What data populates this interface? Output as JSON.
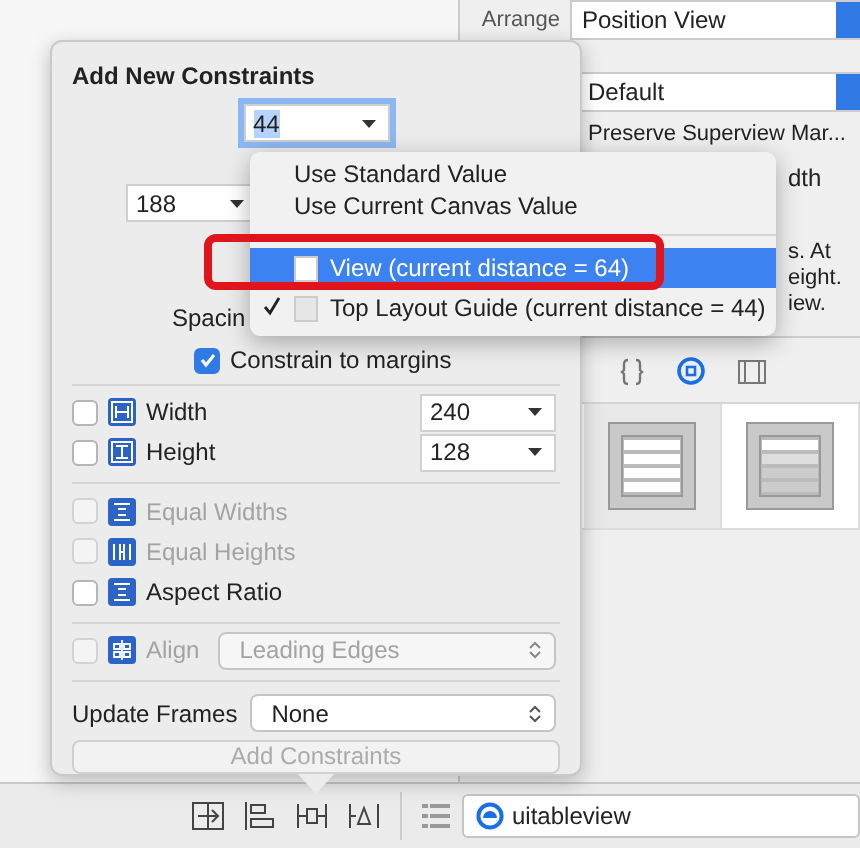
{
  "inspector": {
    "arrange_label": "Arrange",
    "arrange_value": "Position View",
    "layout_value": "Default",
    "preserve_label": "Preserve Superview Mar...",
    "fragments": [
      "dth",
      "s. At",
      "eight.",
      "iew."
    ],
    "library_tabs": [
      {
        "kind": "braces",
        "selected": false
      },
      {
        "kind": "target",
        "selected": true
      },
      {
        "kind": "panel",
        "selected": false
      }
    ],
    "library_cells": [
      {
        "selected": true
      },
      {
        "selected": false
      }
    ]
  },
  "bottom_bar": {
    "tools": [
      {
        "kind": "embed"
      },
      {
        "kind": "align"
      },
      {
        "kind": "pin"
      },
      {
        "kind": "resolve"
      }
    ],
    "search_value": "uitableview"
  },
  "popover": {
    "title": "Add New Constraints",
    "top_field": {
      "value": "44",
      "focused": true
    },
    "left_field": {
      "value": "188"
    },
    "spacing_label": "Spacin",
    "constrain_margins": {
      "label": "Constrain to margins",
      "checked": true
    },
    "size_rows": [
      {
        "kind": "width",
        "label": "Width",
        "checked": false,
        "value": "240"
      },
      {
        "kind": "height",
        "label": "Height",
        "checked": false,
        "value": "128"
      }
    ],
    "relation_rows": [
      {
        "kind": "equal-widths",
        "label": "Equal Widths",
        "checked": false,
        "disabled": true
      },
      {
        "kind": "equal-heights",
        "label": "Equal Heights",
        "checked": false,
        "disabled": true
      },
      {
        "kind": "aspect-ratio",
        "label": "Aspect Ratio",
        "checked": false,
        "disabled": false
      }
    ],
    "align": {
      "label": "Align",
      "value": "Leading Edges",
      "checked": false,
      "disabled": true
    },
    "update_frames": {
      "label": "Update Frames",
      "value": "None"
    },
    "add_button": {
      "label": "Add Constraints",
      "disabled": true
    }
  },
  "menu": {
    "items": [
      {
        "kind": "item",
        "label": "Use Standard Value"
      },
      {
        "kind": "item",
        "label": "Use Current Canvas Value"
      },
      {
        "kind": "separator"
      },
      {
        "kind": "target",
        "label": "View (current distance = 64)",
        "selected": true,
        "checked": false
      },
      {
        "kind": "target",
        "label": "Top Layout Guide (current distance = 44)",
        "selected": false,
        "checked": true
      }
    ]
  }
}
